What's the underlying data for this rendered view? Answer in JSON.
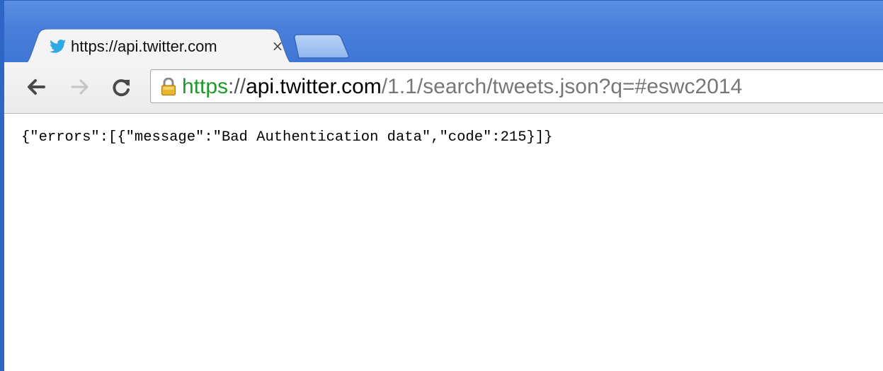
{
  "browser": {
    "tab": {
      "title": "https://api.twitter.com",
      "favicon": "twitter-bird-icon",
      "close_glyph": "×"
    },
    "new_tab": {
      "icon": "new-tab-icon"
    },
    "toolbar": {
      "back_icon": "back-arrow-icon",
      "forward_icon": "forward-arrow-icon",
      "reload_icon": "reload-icon"
    },
    "address_bar": {
      "secure_icon": "lock-icon",
      "scheme": "https",
      "separator": "://",
      "host": "api.twitter.com",
      "path": "/1.1/search/tweets.json?q=#eswc2014"
    },
    "colors": {
      "frame_blue": "#3f75d4",
      "scheme_green": "#1e9a2a",
      "path_gray": "#777777",
      "twitter_blue": "#2fa9e6",
      "lock_gold": "#d6a020"
    }
  },
  "page": {
    "body_text": "{\"errors\":[{\"message\":\"Bad Authentication data\",\"code\":215}]}"
  }
}
